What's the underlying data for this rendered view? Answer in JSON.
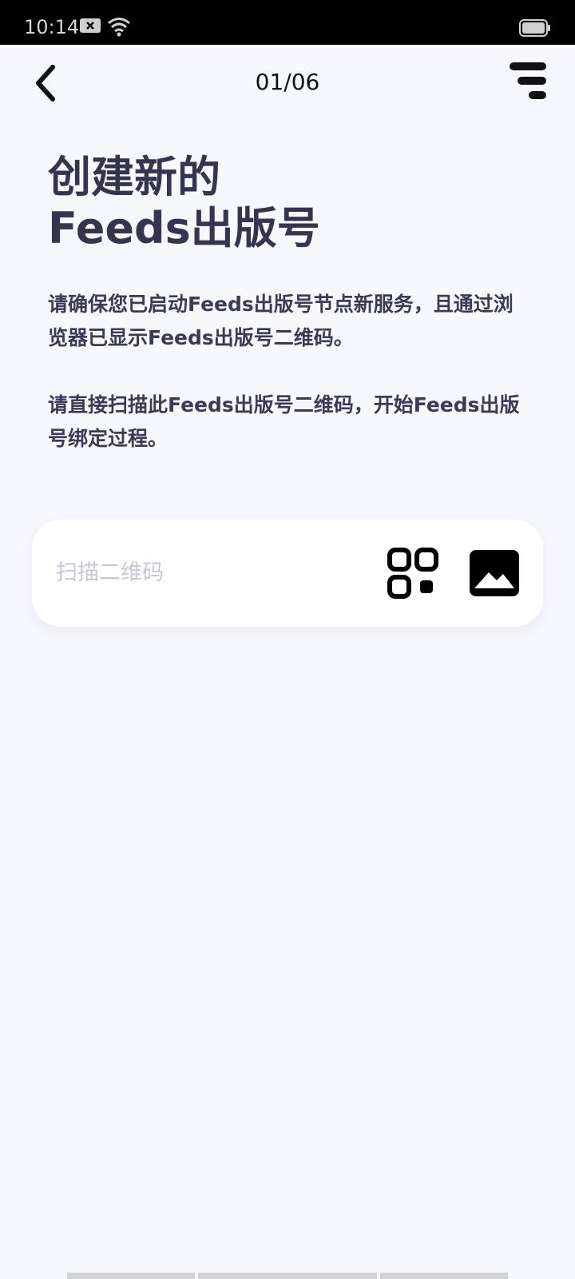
{
  "status_bar": {
    "time": "10:14",
    "icons": [
      "notification-close-icon",
      "wifi-icon",
      "battery-icon"
    ]
  },
  "header": {
    "page_counter": "01/06",
    "back_icon": "chevron-left-icon",
    "menu_icon": "menu-lines-icon"
  },
  "content": {
    "title_line1": "创建新的",
    "title_line2": "Feeds出版号",
    "paragraph1": "请确保您已启动Feeds出版号节点新服务，且通过浏览器已显示Feeds出版号二维码。",
    "paragraph2": "请直接扫描此Feeds出版号二维码，开始Feeds出版号绑定过程。"
  },
  "scan_field": {
    "placeholder": "扫描二维码",
    "value": "",
    "qr_icon": "qr-code-icon",
    "gallery_icon": "image-gallery-icon"
  },
  "colors": {
    "background": "#f7f8fd",
    "text_primary": "#36354f",
    "placeholder": "#c7c6d8",
    "card": "#ffffff"
  }
}
